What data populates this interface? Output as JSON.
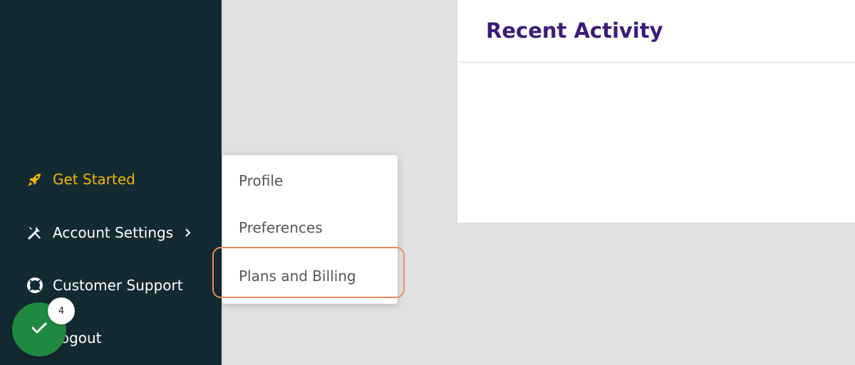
{
  "sidebar": {
    "items": [
      {
        "label": "Get Started",
        "icon": "rocket-icon",
        "active": true
      },
      {
        "label": "Account Settings",
        "icon": "tools-icon"
      },
      {
        "label": "Customer Support",
        "icon": "lifebuoy-icon"
      },
      {
        "label": "Logout",
        "icon": "logout-icon"
      }
    ]
  },
  "submenu": {
    "items": [
      {
        "label": "Profile"
      },
      {
        "label": "Preferences"
      },
      {
        "label": "Plans and Billing"
      }
    ]
  },
  "main": {
    "card_title": "Recent Activity"
  },
  "checklist": {
    "badge_count": "4",
    "icon": "checkmark-icon"
  },
  "colors": {
    "sidebar_bg": "#142a33",
    "active": "#f2b705",
    "title": "#3d1a7a",
    "highlight": "#f08a5d",
    "fab": "#1f8a3f"
  }
}
